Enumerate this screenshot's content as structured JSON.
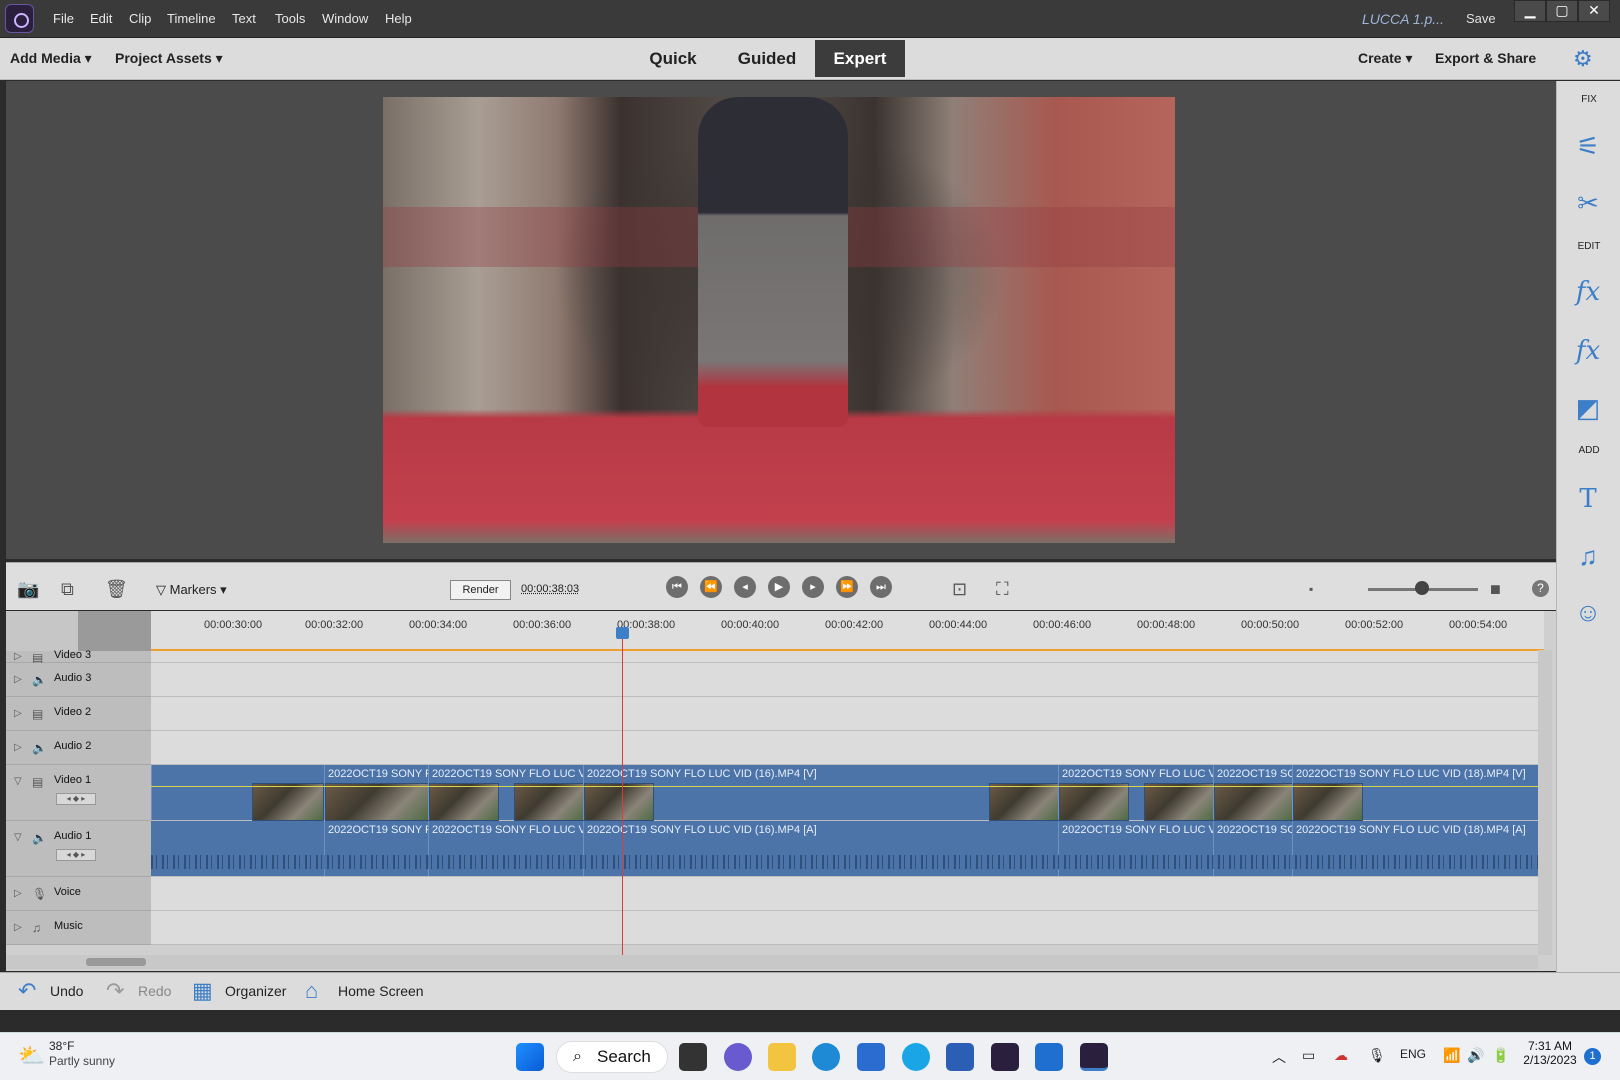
{
  "titlebar": {
    "menus": [
      "File",
      "Edit",
      "Clip",
      "Timeline",
      "Text",
      "Tools",
      "Window",
      "Help"
    ],
    "project_name": "LUCCA 1.p...",
    "save_label": "Save",
    "window_buttons": [
      "▁",
      "▢",
      "✕"
    ]
  },
  "toolbar": {
    "add_media": "Add Media",
    "project_assets": "Project Assets",
    "modes": [
      "Quick",
      "Guided",
      "Expert"
    ],
    "active_mode": "Expert",
    "create": "Create",
    "export_share": "Export & Share"
  },
  "right_panel": {
    "fix_label": "FIX",
    "edit_label": "EDIT",
    "add_label": "ADD",
    "icons": [
      "adjust-sliders-icon",
      "tools-icon",
      "fx-edit-icon",
      "fx-effects-icon",
      "transitions-icon",
      "titles-icon",
      "music-icon",
      "graphics-icon"
    ]
  },
  "timeline_bar": {
    "markers_label": "Markers",
    "render_label": "Render",
    "timecode": "00:00:38:03"
  },
  "ruler": {
    "ticks": [
      "00:00:30:00",
      "00:00:32:00",
      "00:00:34:00",
      "00:00:36:00",
      "00:00:38:00",
      "00:00:40:00",
      "00:00:42:00",
      "00:00:44:00",
      "00:00:46:00",
      "00:00:48:00",
      "00:00:50:00",
      "00:00:52:00",
      "00:00:54:00"
    ]
  },
  "tracks": [
    {
      "label": "Video 3"
    },
    {
      "label": "Audio 3"
    },
    {
      "label": "Video 2"
    },
    {
      "label": "Audio 2"
    },
    {
      "label": "Video 1"
    },
    {
      "label": "Audio 1"
    },
    {
      "label": "Voice"
    },
    {
      "label": "Music"
    }
  ],
  "video_clips": [
    "2022OCT19 SONY F",
    "2022OCT19 SONY FLO LUC VI",
    "2022OCT19 SONY FLO LUC VID (16).MP4 [V]",
    "2022OCT19 SONY FLO LUC VI",
    "2022OCT19 SO",
    "2022OCT19 SONY FLO LUC VID (18).MP4 [V]"
  ],
  "audio_clips": [
    "2022OCT19 SONY F",
    "2022OCT19 SONY FLO LUC VI",
    "2022OCT19 SONY FLO LUC VID (16).MP4 [A]",
    "2022OCT19 SONY FLO LUC VI",
    "2022OCT19 SO",
    "2022OCT19 SONY FLO LUC VID (18).MP4 [A]"
  ],
  "bottom_bar": {
    "undo": "Undo",
    "redo": "Redo",
    "organizer": "Organizer",
    "home_screen": "Home Screen"
  },
  "taskbar": {
    "weather_temp": "38°F",
    "weather_desc": "Partly sunny",
    "search": "Search",
    "lang": "ENG",
    "time": "7:31 AM",
    "date": "2/13/2023",
    "notification_count": "1"
  },
  "colors": {
    "accent": "#3d7ec8",
    "clip": "#4d74a8",
    "playhead": "#e03a3a",
    "ruler_line": "#f0a030"
  }
}
